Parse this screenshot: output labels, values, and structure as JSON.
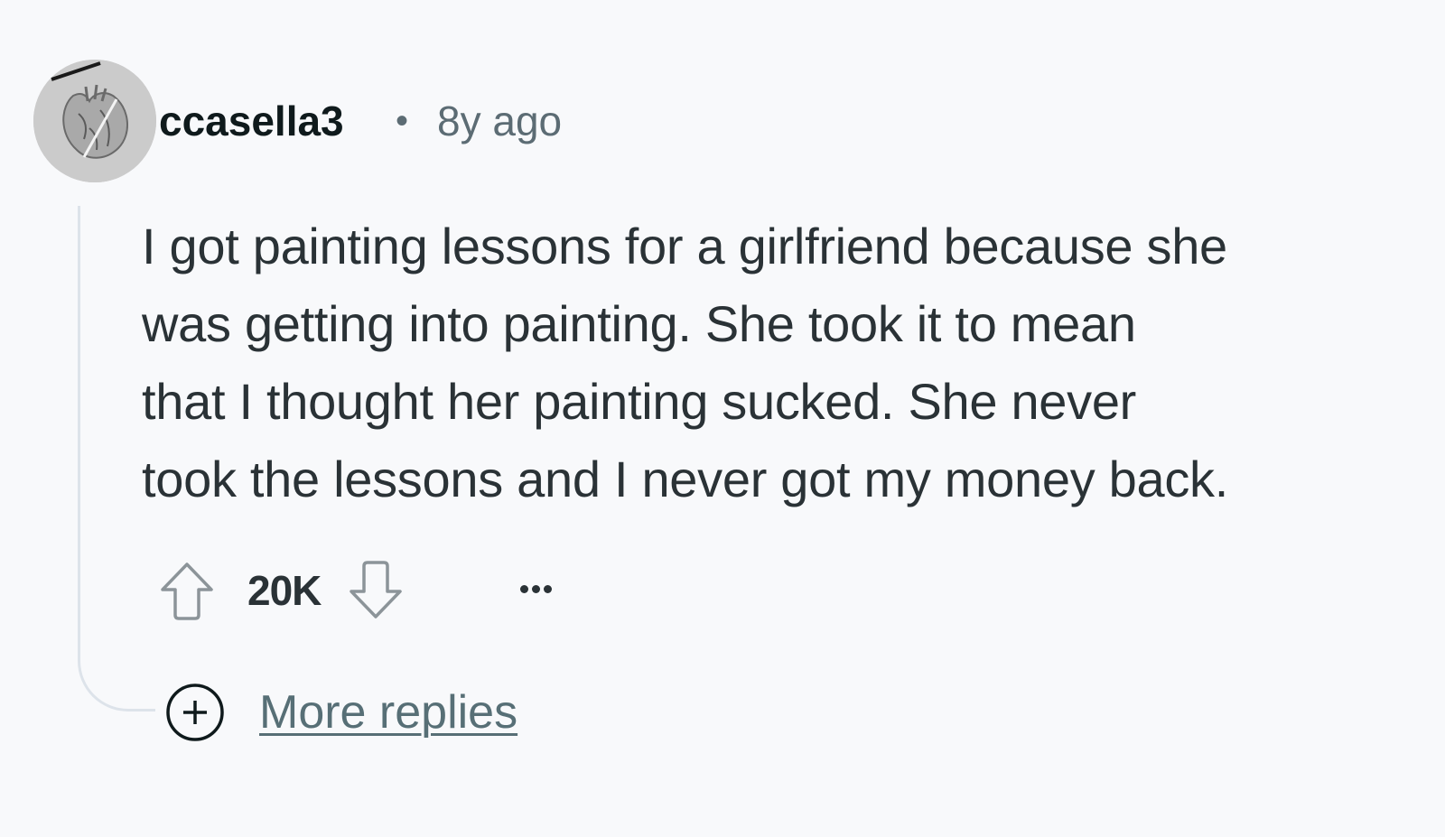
{
  "comment": {
    "author": "ccasella3",
    "separator": "•",
    "age": "8y ago",
    "body_lines": [
      "I got painting lessons for a girlfriend because she",
      "was getting into painting. She took it to mean",
      "that I thought her painting sucked. She never",
      "took the lessons and I never got my money back."
    ],
    "score": "20K",
    "more_replies_label": "More replies"
  },
  "icons": {
    "avatar": "anatomical-heart-sketch-avatar",
    "upvote": "upvote-arrow-icon",
    "downvote": "downvote-arrow-icon",
    "more": "ellipsis-icon",
    "expand": "plus-circle-icon"
  },
  "colors": {
    "background": "#f8f9fb",
    "text": "#2a3236",
    "meta": "#5c6c74",
    "link": "#576f76",
    "thread_line": "#dde3ea"
  }
}
